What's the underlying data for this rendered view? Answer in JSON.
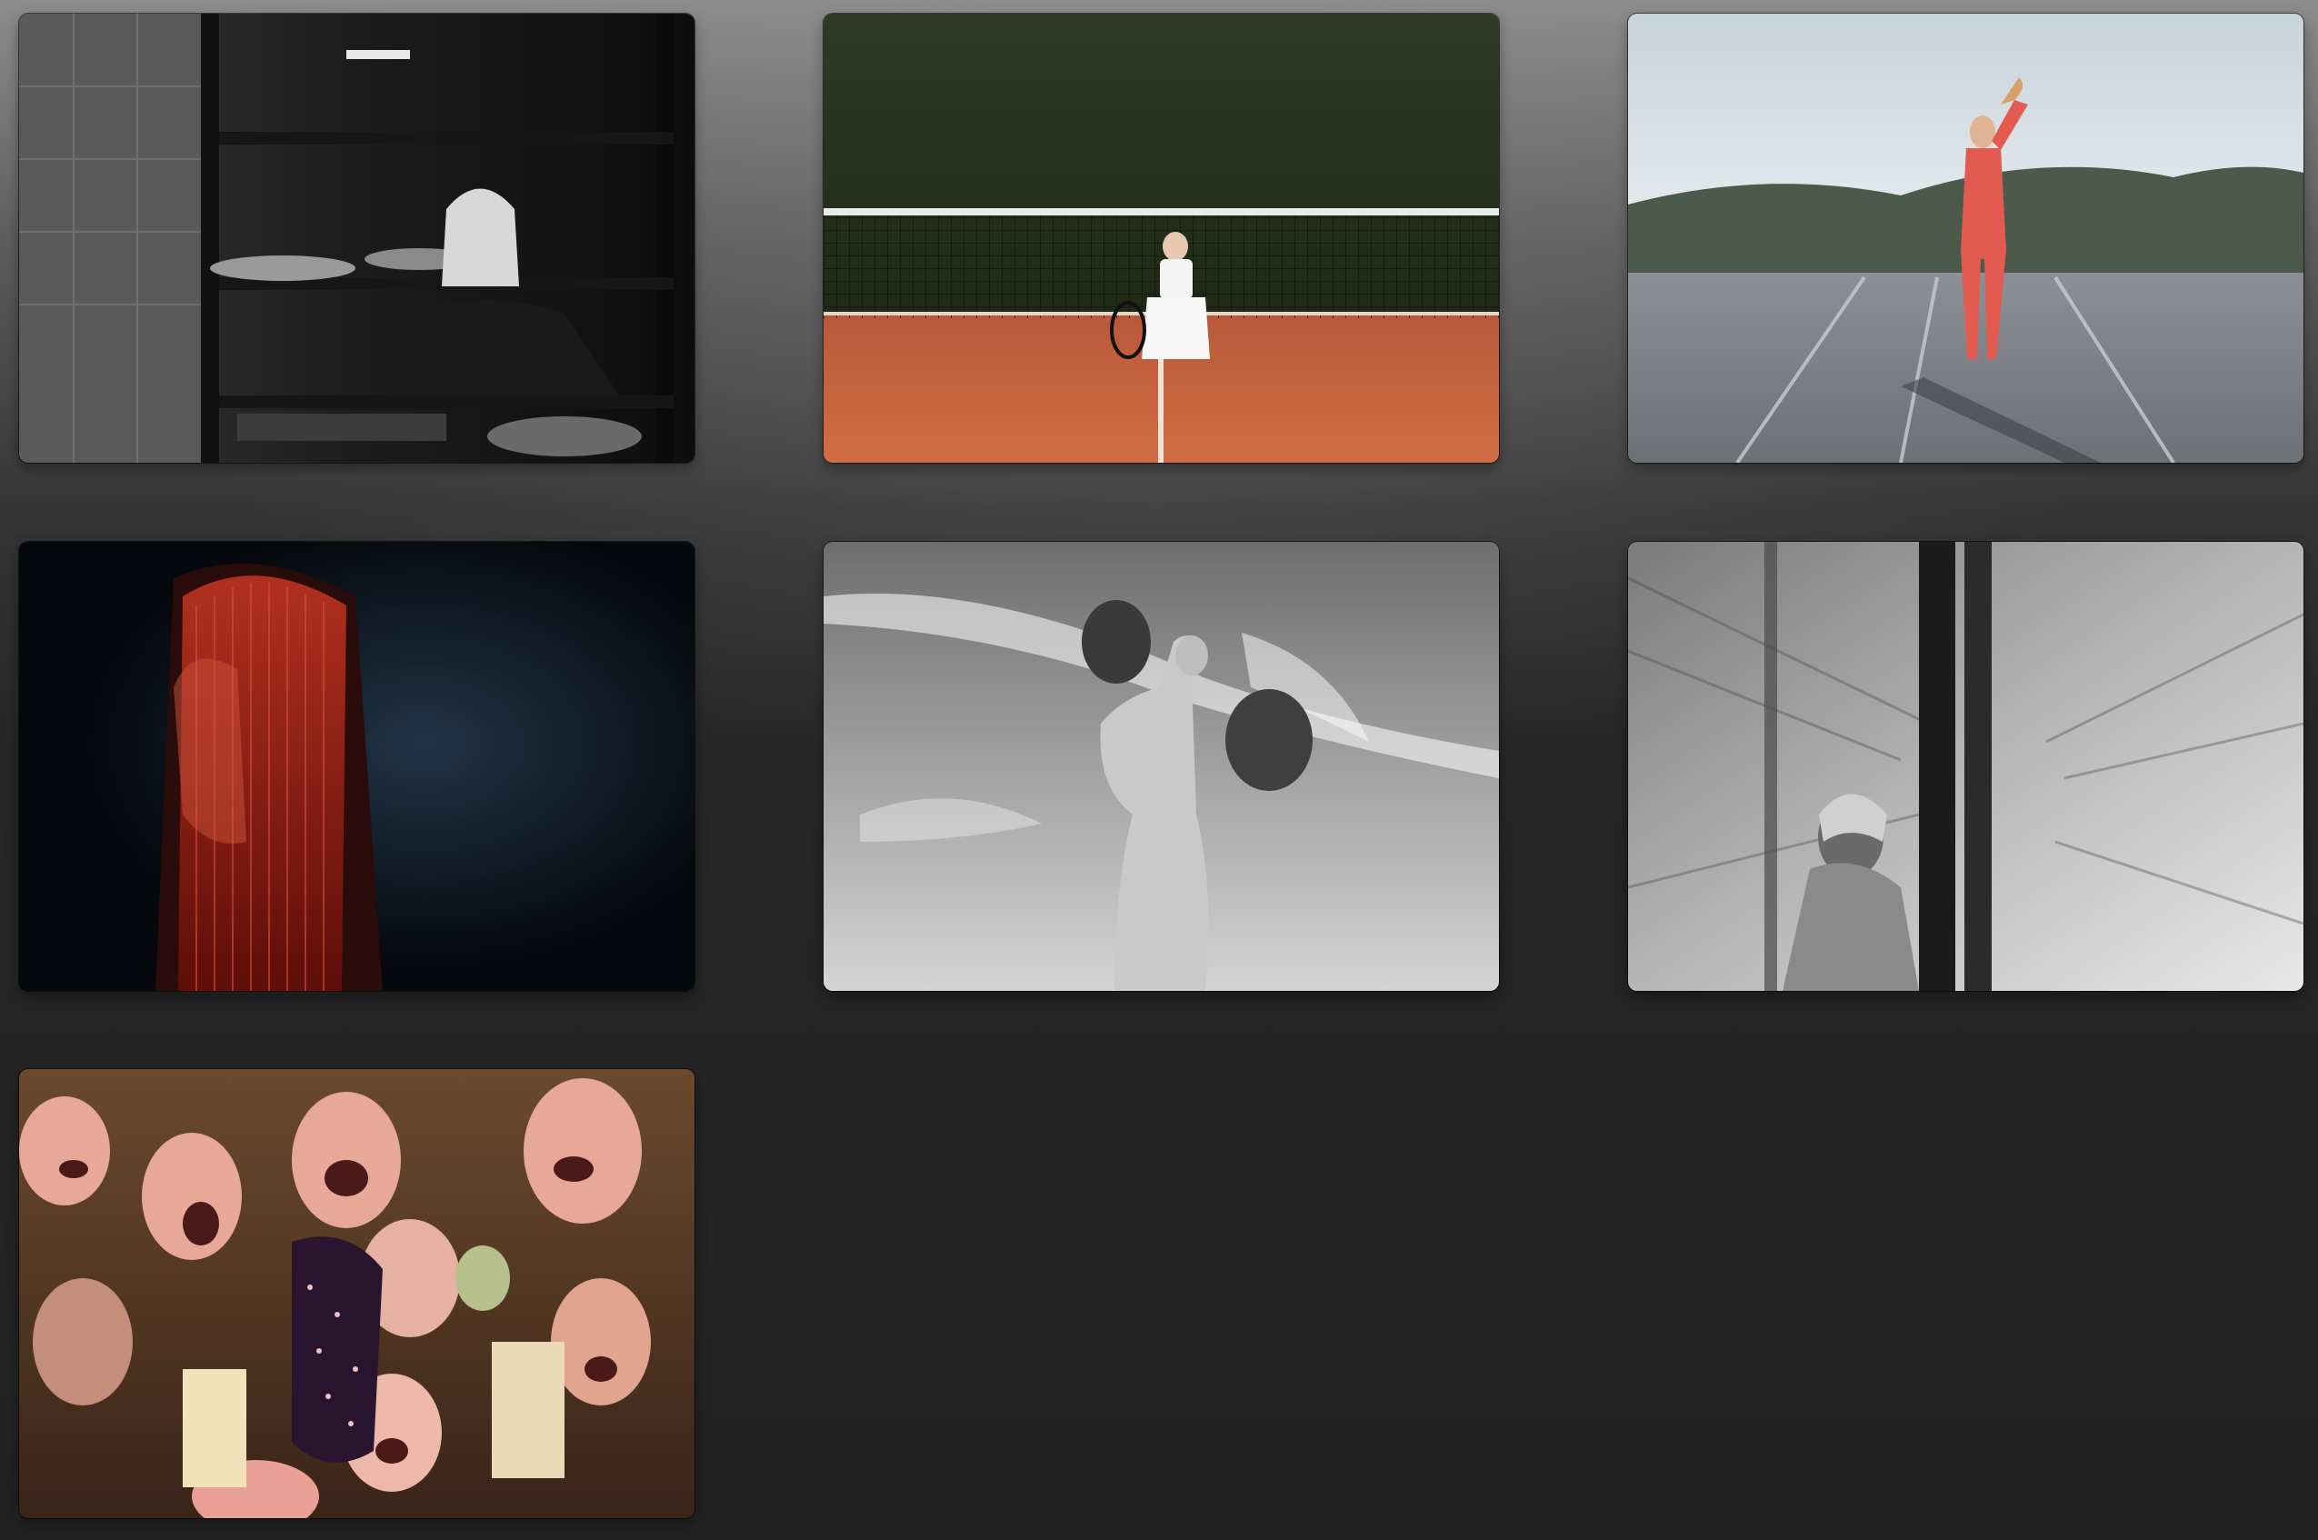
{
  "gallery": {
    "photos": [
      {
        "icon": "kitchen-shelf-portrait-photo-icon",
        "tone": "monochrome"
      },
      {
        "icon": "tennis-court-photo-icon",
        "tone": "color",
        "accent": "#c8643a"
      },
      {
        "icon": "red-bodysuit-rooftop-photo-icon",
        "tone": "color",
        "accent": "#e0564e"
      },
      {
        "icon": "red-hair-curtain-portrait-photo-icon",
        "tone": "color",
        "accent": "#c0281f"
      },
      {
        "icon": "balloons-sky-photo-icon",
        "tone": "monochrome"
      },
      {
        "icon": "motion-blur-window-photo-icon",
        "tone": "monochrome"
      },
      {
        "icon": "masks-crowd-photo-icon",
        "tone": "color",
        "accent": "#e6a394"
      }
    ]
  },
  "colors": {
    "background_top": "#8d8d8d",
    "background_bottom": "#222222"
  }
}
